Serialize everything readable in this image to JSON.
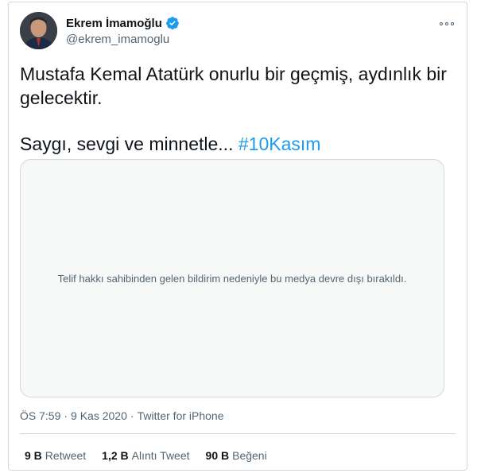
{
  "user": {
    "display_name": "Ekrem İmamoğlu",
    "handle": "@ekrem_imamoglu",
    "verified": true,
    "avatar_icon": "profile-photo"
  },
  "tweet": {
    "line1": "Mustafa Kemal Atatürk onurlu bir geçmiş, aydınlık bir",
    "line2": "gelecektir.",
    "line3_text": "Saygı, sevgi ve minnetle... ",
    "hashtag": "#10Kasım"
  },
  "media": {
    "notice": "Telif hakkı sahibinden gelen bildirim nedeniyle bu medya devre dışı bırakıldı."
  },
  "meta": {
    "time": "ÖS 7:59",
    "separator": "·",
    "date": "9 Kas 2020",
    "source": "Twitter for iPhone"
  },
  "stats": {
    "retweets_count": "9 B",
    "retweets_label": "Retweet",
    "quotes_count": "1,2 B",
    "quotes_label": "Alıntı Tweet",
    "likes_count": "90 B",
    "likes_label": "Beğeni"
  },
  "colors": {
    "accent": "#1d9bf0",
    "text": "#0f1419",
    "secondary": "#536471",
    "border": "#cfd9de"
  }
}
